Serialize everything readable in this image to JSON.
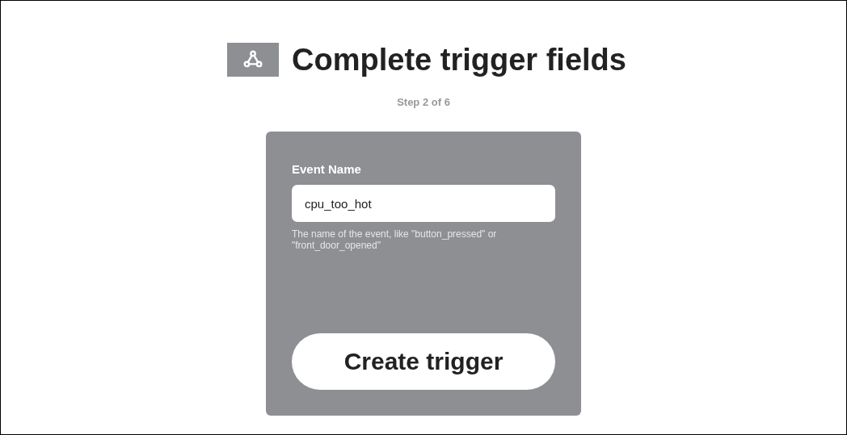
{
  "header": {
    "title": "Complete trigger fields",
    "step": "Step 2 of 6"
  },
  "form": {
    "field": {
      "label": "Event Name",
      "value": "cpu_too_hot",
      "help": "The name of the event, like \"button_pressed\" or \"front_door_opened\""
    },
    "submit": "Create trigger"
  }
}
